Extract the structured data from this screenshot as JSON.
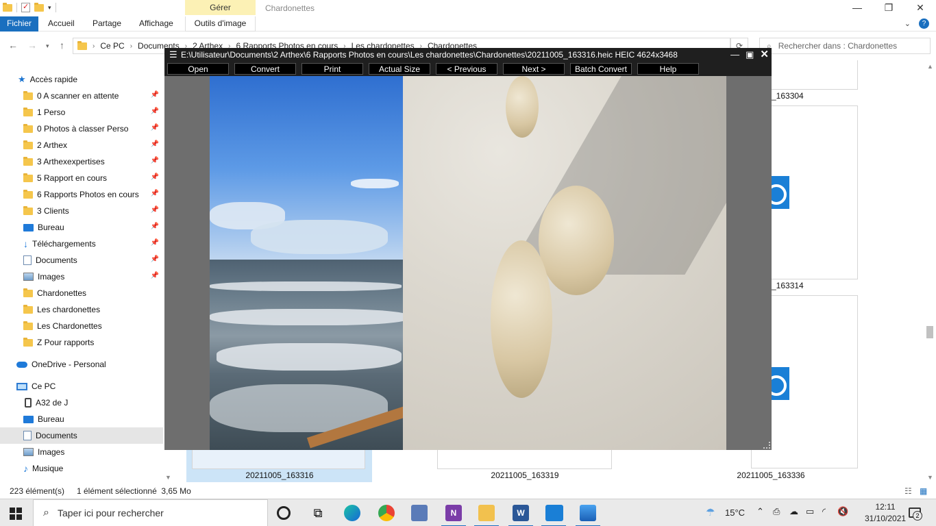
{
  "explorer": {
    "window_title": "Chardonettes",
    "gerer_tab": "Gérer",
    "ribbon_tabs": [
      "Fichier",
      "Accueil",
      "Partage",
      "Affichage",
      "Outils d'image"
    ],
    "address_parts": [
      "Ce PC",
      "Documents",
      "2 Arthex",
      "6 Rapports Photos en cours",
      "Les chardonettes",
      "Chardonettes"
    ],
    "search_placeholder": "Rechercher dans : Chardonettes",
    "nav": {
      "quick_access": "Accès rapide",
      "items": [
        "0 A scanner en attente",
        "1 Perso",
        "0 Photos à classer Perso",
        "2 Arthex",
        "3 Arthexexpertises",
        "5 Rapport en cours",
        "6 Rapports Photos en cours",
        "3 Clients",
        "Bureau",
        "Téléchargements",
        "Documents",
        "Images",
        "Chardonettes",
        "Les chardonettes",
        "Les Chardonettes",
        "Z Pour rapports"
      ],
      "onedrive": "OneDrive - Personal",
      "this_pc": "Ce PC",
      "pc_items": [
        "A32 de J",
        "Bureau",
        "Documents",
        "Images",
        "Musique"
      ]
    },
    "thumbs": {
      "labels_top": [
        "_163304",
        "_163314"
      ],
      "labels_bottom": [
        "20211005_163316",
        "20211005_163319",
        "20211005_163336"
      ]
    },
    "status": {
      "count": "223 élément(s)",
      "selected": "1 élément sélectionné  3,65 Mo"
    }
  },
  "viewer": {
    "title": "E:\\Utilisateur\\Documents\\2 Arthex\\6 Rapports Photos en cours\\Les chardonettes\\Chardonettes\\20211005_163316.heic HEIC 4624x3468",
    "buttons": [
      "Open",
      "Convert",
      "Print",
      "Actual Size",
      "< Previous",
      "Next >",
      "Batch Convert",
      "Help"
    ]
  },
  "taskbar": {
    "search_placeholder": "Taper ici pour rechercher",
    "temperature": "15°C",
    "time": "12:11",
    "date": "31/10/2021",
    "notifications": "2"
  },
  "colors": {
    "accent": "#1a6fbf",
    "gerer": "#fcf1b5",
    "viewer_bar": "#1f1f1f"
  }
}
